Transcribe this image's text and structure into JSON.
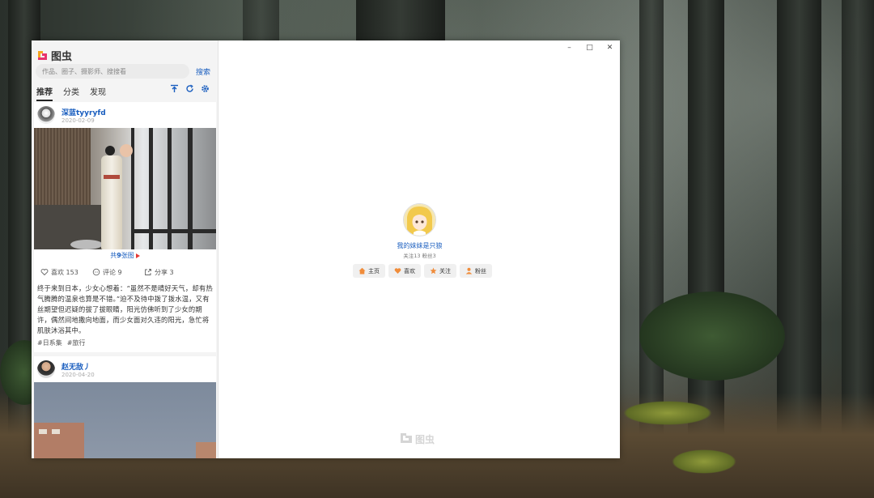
{
  "app": {
    "logo_text": "图虫",
    "brand_colors": {
      "orange": "#f5a623",
      "pink": "#e8336d",
      "link": "#1a5ebf"
    }
  },
  "search": {
    "placeholder": "作品、圈子、摄影师、搜搜看",
    "button_label": "搜索"
  },
  "tabs": [
    {
      "label": "推荐",
      "active": true
    },
    {
      "label": "分类",
      "active": false
    },
    {
      "label": "发现",
      "active": false
    }
  ],
  "toolbar_icons": [
    "scroll-to-top-icon",
    "refresh-icon",
    "settings-gear-icon"
  ],
  "feed": [
    {
      "author": "深蓝tyyryfd",
      "date": "2020-02-09",
      "photo_count_prefix": "共",
      "photo_count": "9",
      "photo_count_suffix": "张图",
      "likes_label": "喜欢 153",
      "comments_label": "评论 9",
      "shares_label": "分享 3",
      "description": "终于来到日本，少女心想着：“虽然不是晴好天气，却有热气腾腾的温泉也算是不错。”迫不及待中拨了拨水温，又有丝期望但迟疑的拔了拔眼睛，阳光仿佛听到了少女的期许，偶然间地撒向地面，而少女面对久违的阳光，急忙将肌肤沐浴其中。",
      "tags": [
        "#日系集",
        "#旅行"
      ]
    },
    {
      "author": "赵无敌丿",
      "date": "2020-04-20"
    }
  ],
  "window_controls": {
    "minimize": "–",
    "maximize": "□",
    "close": "✕"
  },
  "profile": {
    "name": "我的妹妹是只狼",
    "stats": "关注13  粉丝3",
    "buttons": [
      {
        "label": "主页",
        "icon": "home-icon"
      },
      {
        "label": "喜欢",
        "icon": "heart-icon"
      },
      {
        "label": "关注",
        "icon": "star-icon"
      },
      {
        "label": "粉丝",
        "icon": "user-icon"
      }
    ]
  },
  "watermark": {
    "text": "图虫"
  }
}
